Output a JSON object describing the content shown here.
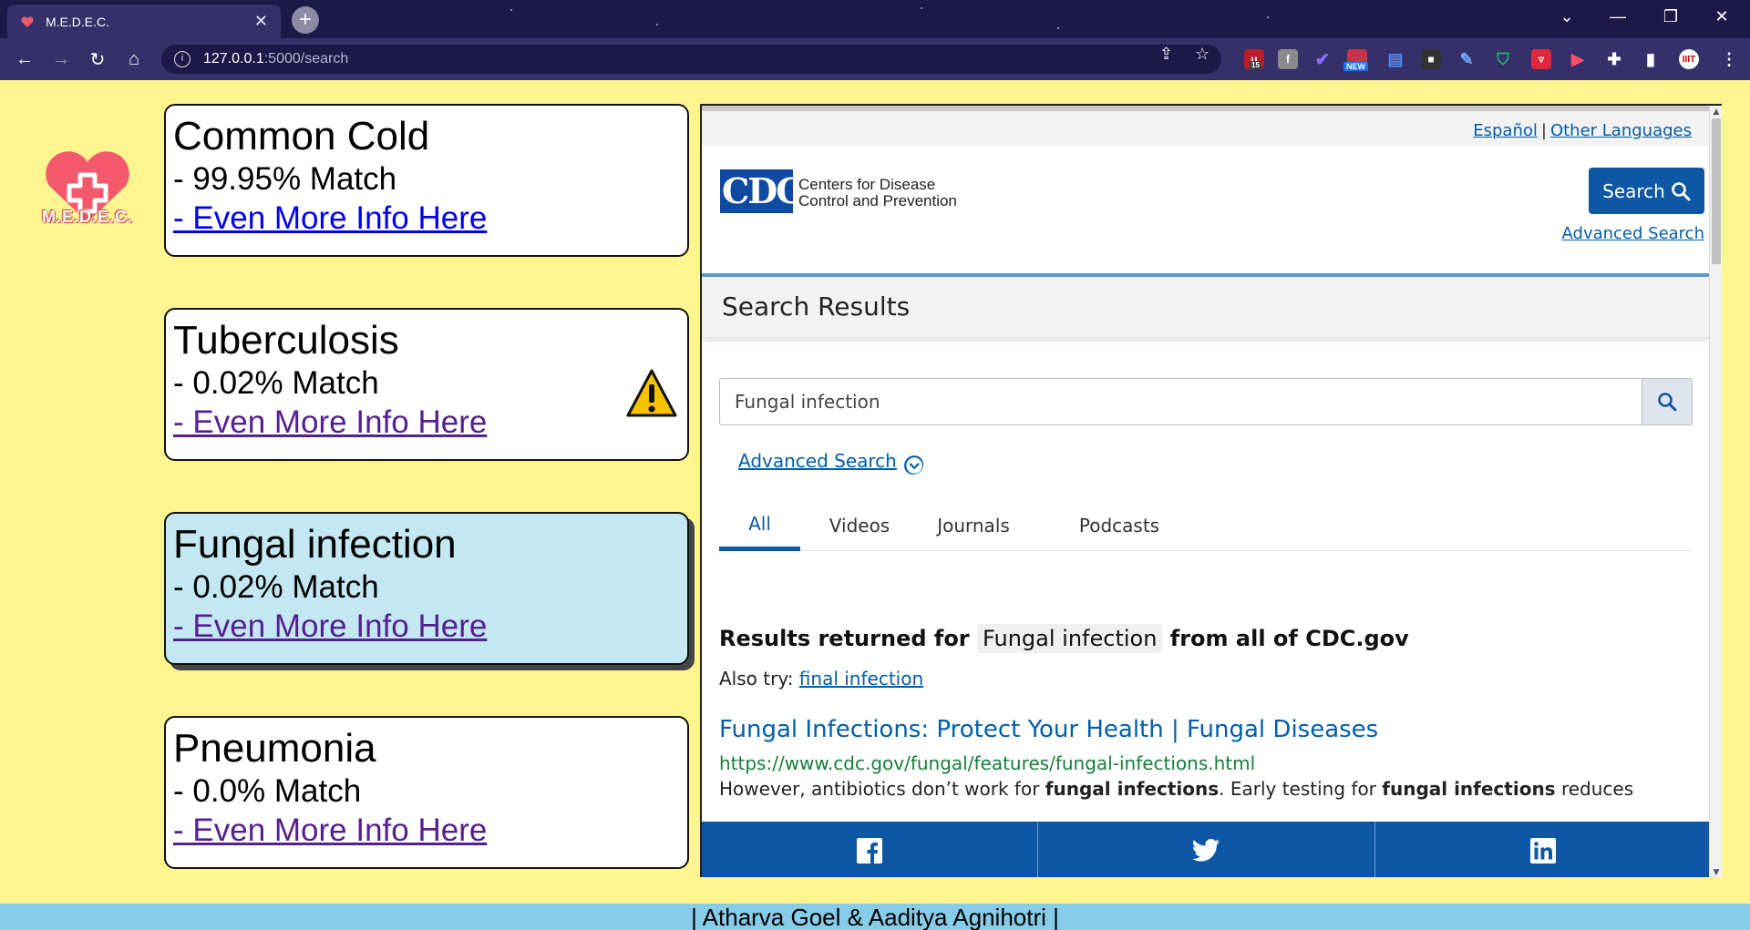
{
  "browser": {
    "tab_title": "M.E.D.E.C.",
    "url_host": "127.0.0.1",
    "url_path": ":5000/search",
    "extension_badges": [
      "15",
      "NEW"
    ]
  },
  "app": {
    "logo_text": "M.E.D.E.C.",
    "footer": "| Atharva Goel & Aaditya Agnihotri |",
    "results": [
      {
        "name": "Common Cold",
        "match": "- 99.95% Match",
        "link": "- Even More Info Here",
        "warning": false
      },
      {
        "name": "Tuberculosis",
        "match": "- 0.02% Match",
        "link": "- Even More Info Here",
        "warning": true
      },
      {
        "name": "Fungal infection",
        "match": "- 0.02% Match",
        "link": "- Even More Info Here",
        "warning": false
      },
      {
        "name": "Pneumonia",
        "match": "- 0.0% Match",
        "link": "- Even More Info Here",
        "warning": false
      }
    ]
  },
  "cdc": {
    "lang_es": "Español",
    "lang_sep": "|",
    "lang_other": "Other Languages",
    "logo_text": "CDC",
    "org_line1": "Centers for Disease",
    "org_line2": "Control and Prevention",
    "search_button": "Search",
    "advanced_search": "Advanced Search",
    "results_heading": "Search Results",
    "query": "Fungal infection",
    "advanced_search_toggle": "Advanced Search",
    "tabs": [
      "All",
      "Videos",
      "Journals",
      "Podcasts"
    ],
    "returned_prefix": "Results returned for",
    "returned_term": "Fungal infection",
    "returned_suffix": "from all of CDC.gov",
    "also_try_label": "Also try:",
    "also_try_link": "final infection",
    "result_title": "Fungal Infections: Protect Your Health | Fungal Diseases",
    "result_url": "https://www.cdc.gov/fungal/features/fungal-infections.html",
    "snippet_1": "However, antibiotics don’t work for ",
    "snippet_bold_1": "fungal infections",
    "snippet_2": ". Early testing for ",
    "snippet_bold_2": "fungal infections",
    "snippet_3": " reduces"
  },
  "colors": {
    "page_bg": "#fef590",
    "active_card": "#c3e8f3",
    "footer_bg": "#87cce8",
    "cdc_blue": "#0d57a4"
  }
}
